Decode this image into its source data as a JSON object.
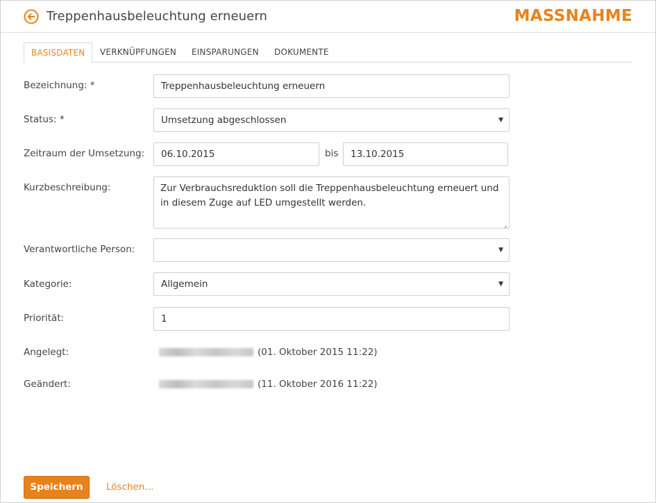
{
  "header": {
    "title": "Treppenhausbeleuchtung erneuern",
    "brand": "MASSNAHME",
    "back_icon": "arrow-left-circle-icon"
  },
  "colors": {
    "accent": "#e8821c",
    "border": "#cfcfcf",
    "text": "#444444"
  },
  "tabs": [
    {
      "label": "BASISDATEN",
      "active": true
    },
    {
      "label": "VERKNÜPFUNGEN",
      "active": false
    },
    {
      "label": "EINSPARUNGEN",
      "active": false
    },
    {
      "label": "DOKUMENTE",
      "active": false
    }
  ],
  "form": {
    "bezeichnung": {
      "label": "Bezeichnung: *",
      "value": "Treppenhausbeleuchtung erneuern"
    },
    "status": {
      "label": "Status: *",
      "value": "Umsetzung abgeschlossen"
    },
    "zeitraum": {
      "label": "Zeitraum der Umsetzung:",
      "from": "06.10.2015",
      "separator": "bis",
      "to": "13.10.2015"
    },
    "kurzbeschreibung": {
      "label": "Kurzbeschreibung:",
      "value": "Zur Verbrauchsreduktion soll die Treppenhausbeleuchtung erneuert und in diesem Zuge auf LED umgestellt werden."
    },
    "verantwortlich": {
      "label": "Verantwortliche Person:",
      "value": ""
    },
    "kategorie": {
      "label": "Kategorie:",
      "value": "Allgemein"
    },
    "prioritaet": {
      "label": "Priorität:",
      "value": "1"
    },
    "angelegt": {
      "label": "Angelegt:",
      "timestamp": "(01. Oktober 2015 11:22)"
    },
    "geaendert": {
      "label": "Geändert:",
      "timestamp": "(11. Oktober 2016 11:22)"
    }
  },
  "actions": {
    "save_label": "Speichern",
    "delete_label": "Löschen..."
  }
}
